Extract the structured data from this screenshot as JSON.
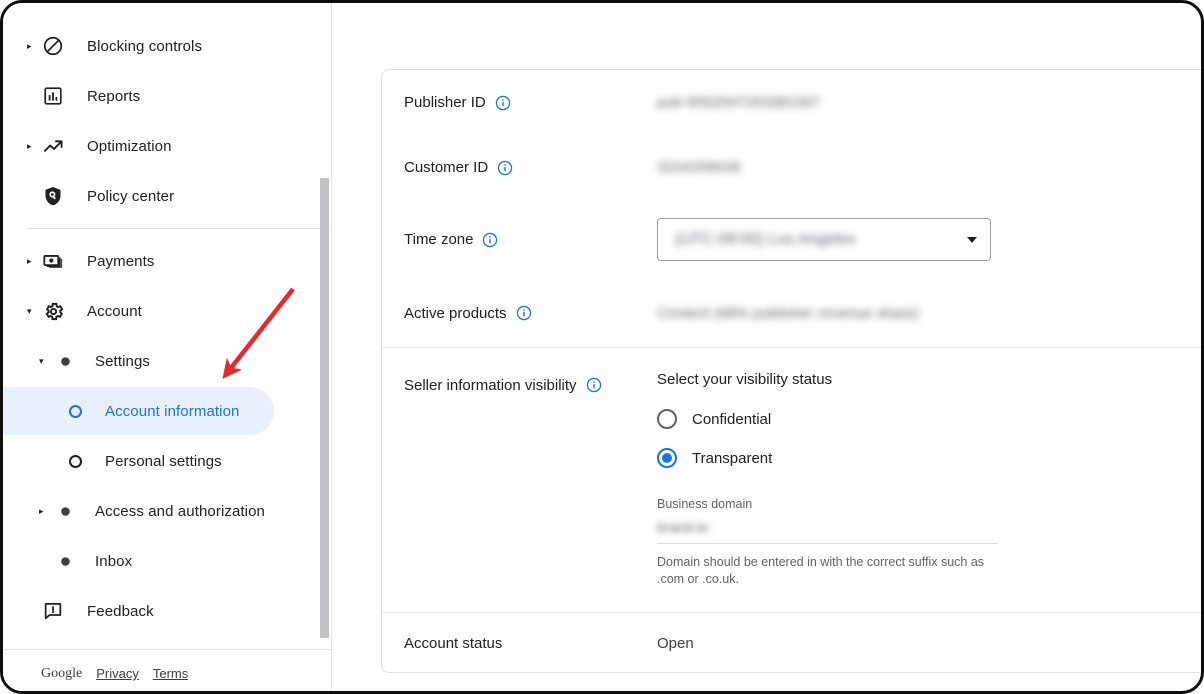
{
  "sidebar": {
    "items": [
      {
        "label": "Blocking controls",
        "icon": "block-icon",
        "expandable": true,
        "level": 0
      },
      {
        "label": "Reports",
        "icon": "bar-chart-icon",
        "expandable": false,
        "level": 0
      },
      {
        "label": "Optimization",
        "icon": "trending-up-icon",
        "expandable": true,
        "level": 0
      },
      {
        "label": "Policy center",
        "icon": "policy-shield-icon",
        "expandable": false,
        "level": 0
      },
      {
        "label": "Payments",
        "icon": "payments-icon",
        "expandable": true,
        "level": 0
      },
      {
        "label": "Account",
        "icon": "gear-icon",
        "expandable": true,
        "expanded": true,
        "level": 0
      },
      {
        "label": "Settings",
        "icon": "dot-filled-icon",
        "expandable": true,
        "expanded": true,
        "level": 1
      },
      {
        "label": "Account information",
        "icon": "dot-ring-icon",
        "selected": true,
        "level": 2
      },
      {
        "label": "Personal settings",
        "icon": "dot-ring-icon",
        "selected": false,
        "level": 2
      },
      {
        "label": "Access and authorization",
        "icon": "dot-filled-icon",
        "expandable": true,
        "level": 1
      },
      {
        "label": "Inbox",
        "icon": "dot-filled-icon",
        "expandable": false,
        "level": 1
      },
      {
        "label": "Feedback",
        "icon": "feedback-icon",
        "expandable": false,
        "level": 0
      }
    ],
    "footer": {
      "brand": "Google",
      "privacy": "Privacy",
      "terms": "Terms"
    }
  },
  "main": {
    "rows": {
      "publisher_id": {
        "label": "Publisher ID",
        "value": "pub-9052947263381567",
        "redacted": true
      },
      "customer_id": {
        "label": "Customer ID",
        "value": "3224259028",
        "redacted": true
      },
      "time_zone": {
        "label": "Time zone",
        "value": "(UTC-08:00) Los Angeles",
        "redacted": true
      },
      "active_products": {
        "label": "Active products",
        "value": "Content (68% publisher revenue share)",
        "redacted": true
      },
      "seller_information_visibility": {
        "label": "Seller information visibility",
        "heading": "Select your visibility status",
        "options": [
          {
            "label": "Confidential",
            "selected": false
          },
          {
            "label": "Transparent",
            "selected": true
          }
        ],
        "business_domain": {
          "caption": "Business domain",
          "value": "brand.to",
          "redacted": true,
          "helper": "Domain should be entered in with the correct suffix such as .com or .co.uk."
        }
      },
      "account_status": {
        "label": "Account status",
        "value": "Open",
        "redacted": false
      }
    }
  },
  "annotation": {
    "arrow_color": "#e8282b"
  },
  "colors": {
    "accent": "#1a73e8",
    "selected_bg": "#e8f0fe",
    "text_primary": "#202124",
    "text_secondary": "#5f6368",
    "divider": "#e3e3e3"
  }
}
